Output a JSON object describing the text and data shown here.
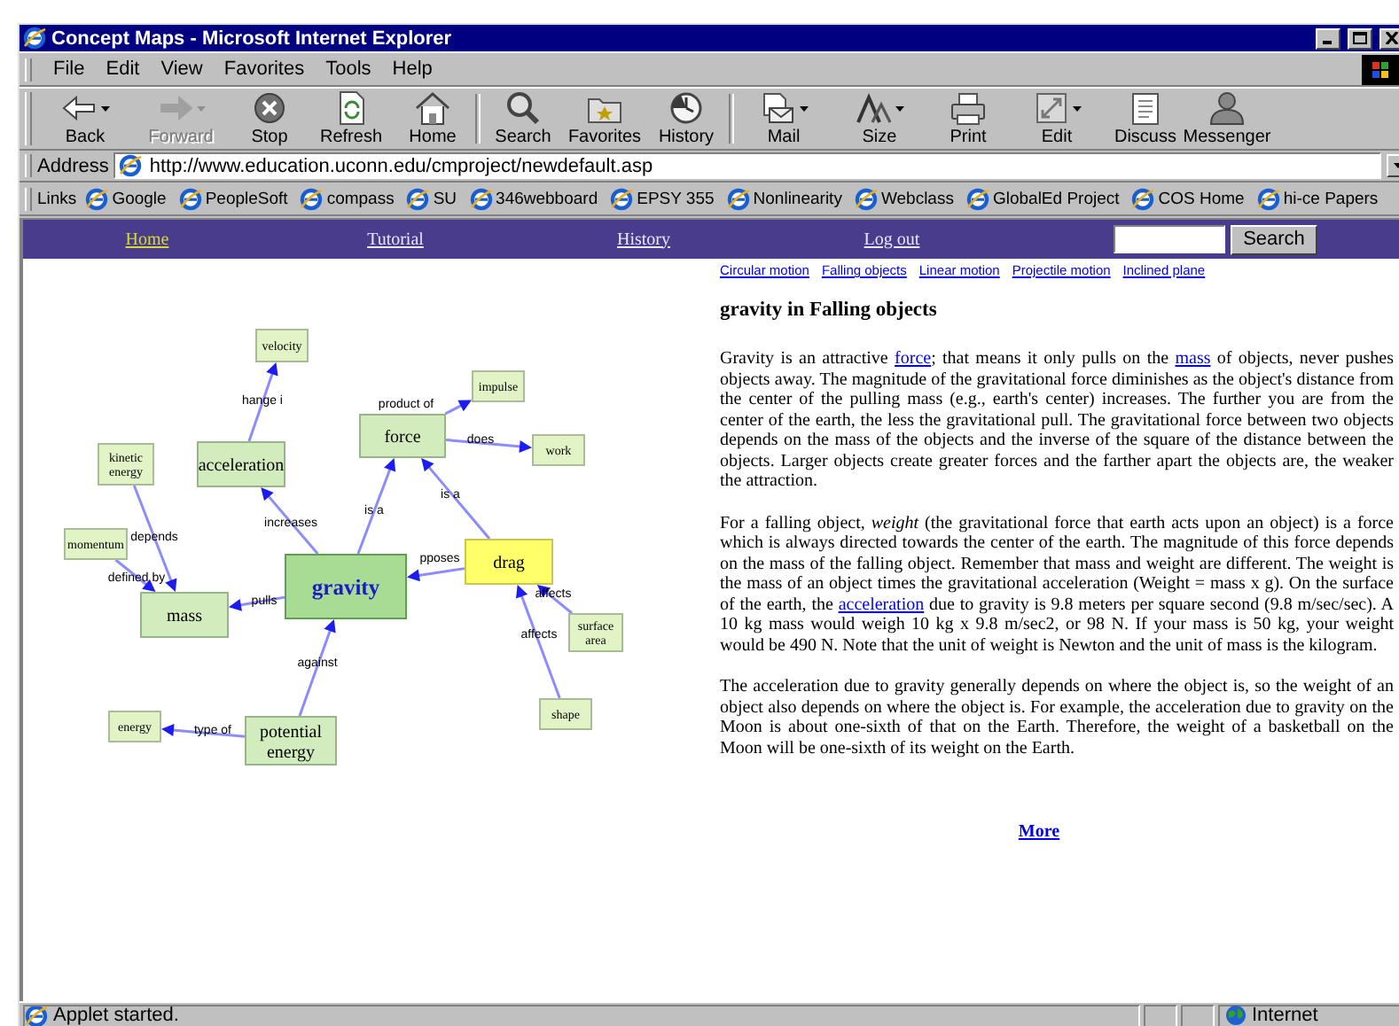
{
  "window": {
    "title": "Concept Maps - Microsoft Internet Explorer"
  },
  "menu": [
    "File",
    "Edit",
    "View",
    "Favorites",
    "Tools",
    "Help"
  ],
  "toolbar": [
    [
      {
        "kind": "back",
        "label": "Back",
        "disabled": false,
        "dropdown": true
      },
      {
        "kind": "forward",
        "label": "Forward",
        "disabled": true,
        "dropdown": true
      },
      {
        "kind": "stop",
        "label": "Stop",
        "disabled": false,
        "dropdown": false
      },
      {
        "kind": "refresh",
        "label": "Refresh",
        "disabled": false,
        "dropdown": false
      },
      {
        "kind": "home",
        "label": "Home",
        "disabled": false,
        "dropdown": false
      }
    ],
    [
      {
        "kind": "search",
        "label": "Search",
        "disabled": false,
        "dropdown": false
      },
      {
        "kind": "favorites",
        "label": "Favorites",
        "disabled": false,
        "dropdown": false
      },
      {
        "kind": "history",
        "label": "History",
        "disabled": false,
        "dropdown": false
      }
    ],
    [
      {
        "kind": "mail",
        "label": "Mail",
        "disabled": false,
        "dropdown": true
      },
      {
        "kind": "size",
        "label": "Size",
        "disabled": false,
        "dropdown": true
      },
      {
        "kind": "print",
        "label": "Print",
        "disabled": false,
        "dropdown": false
      },
      {
        "kind": "edit",
        "label": "Edit",
        "disabled": false,
        "dropdown": true
      },
      {
        "kind": "discuss",
        "label": "Discuss",
        "disabled": false,
        "dropdown": false
      },
      {
        "kind": "messenger",
        "label": "Messenger",
        "disabled": false,
        "dropdown": false
      }
    ]
  ],
  "address": {
    "label": "Address",
    "url": "http://www.education.uconn.edu/cmproject/newdefault.asp"
  },
  "links": {
    "label": "Links",
    "items": [
      "Google",
      "PeopleSoft",
      "compass",
      "SU",
      "346webboard",
      "EPSY 355",
      "Nonlinearity",
      "Webclass",
      "GlobalEd Project",
      "COS Home",
      "hi-ce Papers"
    ]
  },
  "nav": {
    "items": [
      {
        "label": "Home",
        "selected": true
      },
      {
        "label": "Tutorial",
        "selected": false
      },
      {
        "label": "History",
        "selected": false
      },
      {
        "label": "Log out",
        "selected": false
      }
    ],
    "search_button": "Search"
  },
  "map": {
    "nodes": [
      {
        "label": "velocity",
        "kind": "minor",
        "selected": false
      },
      {
        "label": "impulse",
        "kind": "minor",
        "selected": false
      },
      {
        "label": "force",
        "kind": "concept",
        "selected": false
      },
      {
        "label": "work",
        "kind": "minor",
        "selected": false
      },
      {
        "label": "kinetic energy",
        "kind": "minor",
        "selected": false
      },
      {
        "label": "acceleration",
        "kind": "concept",
        "selected": false
      },
      {
        "label": "momentum",
        "kind": "minor",
        "selected": false
      },
      {
        "label": "mass",
        "kind": "concept",
        "selected": false
      },
      {
        "label": "gravity",
        "kind": "focus",
        "selected": false
      },
      {
        "label": "drag",
        "kind": "concept",
        "selected": true
      },
      {
        "label": "surface area",
        "kind": "minor",
        "selected": false
      },
      {
        "label": "shape",
        "kind": "minor",
        "selected": false
      },
      {
        "label": "energy",
        "kind": "minor",
        "selected": false
      },
      {
        "label": "potential energy",
        "kind": "concept",
        "selected": false
      }
    ],
    "connections": [
      "hange i",
      "product of",
      "does",
      "increases",
      "is a",
      "is a",
      "depends",
      "defined by",
      "pulls",
      "pposes",
      "affects",
      "affects",
      "against",
      "type of"
    ]
  },
  "article": {
    "topics": [
      "Circular motion",
      "Falling objects",
      "Linear motion",
      "Projectile motion",
      "Inclined plane"
    ],
    "heading": "gravity in Falling objects",
    "paragraphs": [
      [
        {
          "kind": "text",
          "text": "Gravity is an attractive "
        },
        {
          "kind": "link",
          "text": "force"
        },
        {
          "kind": "text",
          "text": "; that means it only pulls on the "
        },
        {
          "kind": "link",
          "text": "mass"
        },
        {
          "kind": "text",
          "text": " of objects, never pushes objects away. The magnitude of the gravitational force diminishes as the object's distance from the center of the pulling mass (e.g., earth's center) increases. The further you are from the center of the earth, the less the gravitational pull. The gravitational force between two objects depends on the mass of the objects and the inverse of the square of the distance between the objects. Larger objects create greater forces and the farther apart the objects are, the weaker the attraction."
        }
      ],
      [
        {
          "kind": "text",
          "text": "For a falling object, *weight* (the gravitational force that earth acts upon an object) is a force which is always directed towards the center of the earth. The magnitude of this force depends on the mass of the falling object. Remember that mass and weight are different. The weight is the mass of an object times the gravitational acceleration (Weight = mass x g). On the surface of the earth, the "
        },
        {
          "kind": "link",
          "text": "acceleration"
        },
        {
          "kind": "text",
          "text": " due to gravity is 9.8 meters per square second (9.8 m/sec/sec). A 10 kg mass would weigh 10 kg x 9.8 m/sec2, or 98 N. If your mass is 50 kg, your weight would be 490 N. Note that the unit of weight is Newton and the unit of mass is the kilogram."
        }
      ],
      [
        {
          "kind": "text",
          "text": "The acceleration due to gravity generally depends on where the object is, so the weight of an object also depends on where the object is. For example, the acceleration due to gravity on the Moon is about one-sixth of that on the Earth. Therefore, the weight of a basketball on the Moon will be one-sixth of its weight on the Earth."
        }
      ]
    ],
    "more": "More"
  },
  "status_bar": {
    "text": "Applet started.",
    "zone": "Internet"
  }
}
